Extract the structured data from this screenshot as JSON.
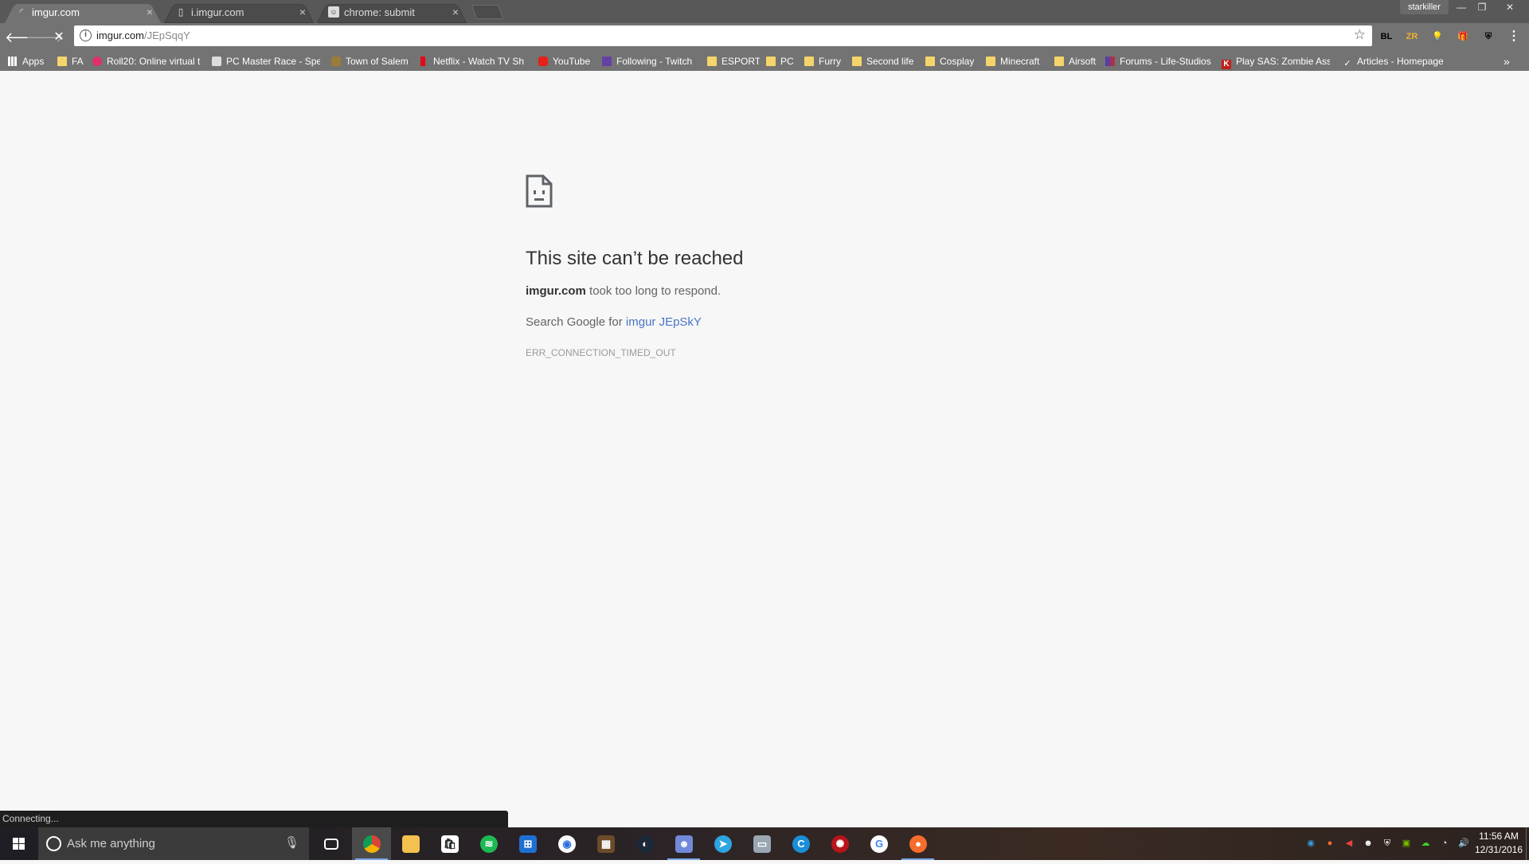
{
  "browser": {
    "tabs": [
      {
        "title": "imgur.com",
        "close": "×",
        "state": "active-loading"
      },
      {
        "title": "i.imgur.com",
        "close": "×",
        "state": "inactive"
      },
      {
        "title": "chrome: submit",
        "close": "×",
        "state": "inactive"
      }
    ],
    "profile_name": "starkiller",
    "window_controls": {
      "minimize": "—",
      "restore": "❐",
      "close": "✕"
    },
    "omnibox": {
      "url_host": "imgur.com",
      "url_path": "/JEpSqqY"
    },
    "extensions": [
      {
        "label": "BL",
        "color": "#ffffff"
      },
      {
        "label": "ZR",
        "color": "#f0b030"
      },
      {
        "label": "💡",
        "color": "#ffffff"
      },
      {
        "label": "🎁",
        "color": "#e05050"
      },
      {
        "label": "⛨",
        "color": "#ffffff"
      }
    ],
    "bookmarks": [
      {
        "label": "Apps",
        "icon": "apps-icon"
      },
      {
        "label": "FA",
        "icon": "folder"
      },
      {
        "label": "Roll20: Online virtual t",
        "icon": "roll20-icon"
      },
      {
        "label": "PC Master Race - Spe",
        "icon": "pcmr-icon"
      },
      {
        "label": "Town of Salem",
        "icon": "salem-icon"
      },
      {
        "label": "Netflix - Watch TV Sh",
        "icon": "netflix-icon"
      },
      {
        "label": "YouTube",
        "icon": "youtube-icon"
      },
      {
        "label": "Following - Twitch",
        "icon": "twitch-icon"
      },
      {
        "label": "ESPORT",
        "icon": "folder"
      },
      {
        "label": "PC",
        "icon": "folder"
      },
      {
        "label": "Furry",
        "icon": "folder"
      },
      {
        "label": "Second life",
        "icon": "folder"
      },
      {
        "label": "Cosplay",
        "icon": "folder"
      },
      {
        "label": "Minecraft",
        "icon": "folder"
      },
      {
        "label": "Airsoft",
        "icon": "folder"
      },
      {
        "label": "Forums - Life-Studios",
        "icon": "lifestudios-icon"
      },
      {
        "label": "Play SAS: Zombie Ass",
        "icon": "kongregate-icon"
      },
      {
        "label": "Articles - Homepage",
        "icon": "articles-icon"
      }
    ],
    "bookmarks_overflow": "»"
  },
  "error_page": {
    "title": "This site can’t be reached",
    "host": "imgur.com",
    "message": " took too long to respond.",
    "search_prefix": "Search Google for ",
    "search_link": "imgur JEpSkY",
    "code": "ERR_CONNECTION_TIMED_OUT"
  },
  "status_bar": "Connecting...",
  "taskbar": {
    "search_placeholder": "Ask me anything",
    "clock_time": "11:56 AM",
    "clock_date": "12/31/2016"
  }
}
